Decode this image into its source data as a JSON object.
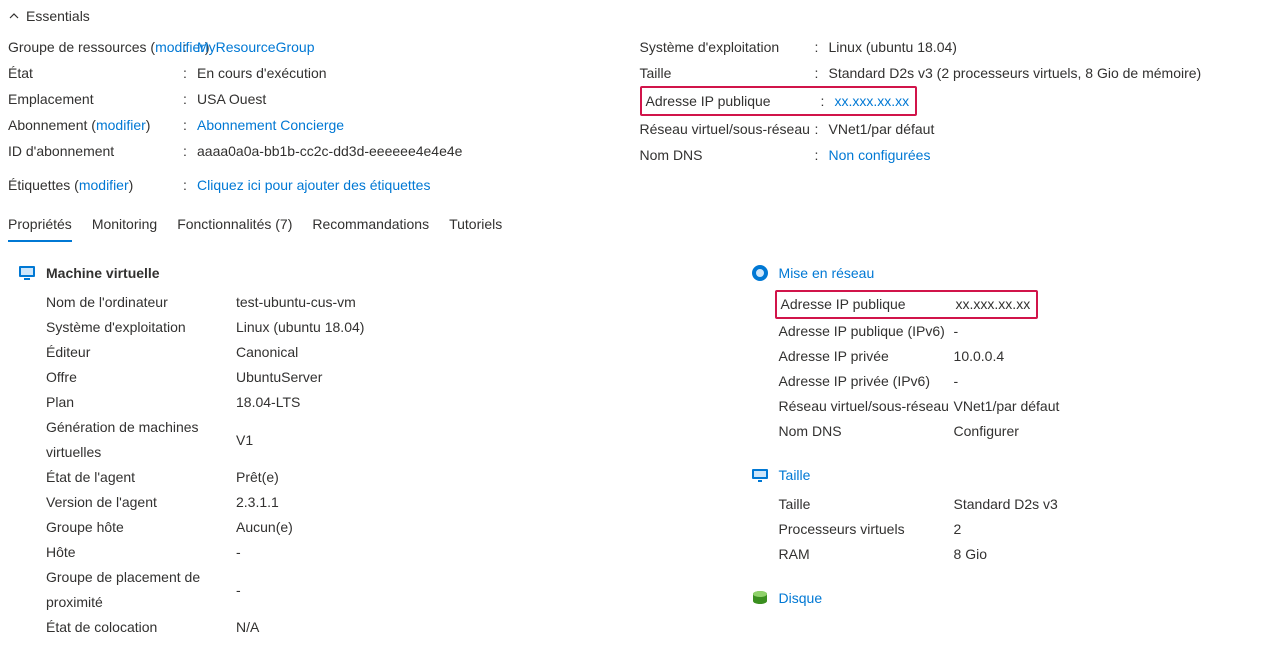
{
  "essentials": {
    "header": "Essentials",
    "left": {
      "resourceGroup_label": "Groupe de ressources",
      "resourceGroup_modify": "modifier",
      "resourceGroup_value": "MyResourceGroup",
      "status_label": "État",
      "status_value": "En cours d'exécution",
      "location_label": "Emplacement",
      "location_value": "USA Ouest",
      "subscription_label": "Abonnement",
      "subscription_modify": "modifier",
      "subscription_value": "Abonnement Concierge",
      "subId_label": "ID d'abonnement",
      "subId_value": "aaaa0a0a-bb1b-cc2c-dd3d-eeeeee4e4e4e",
      "tags_label": "Étiquettes",
      "tags_modify": "modifier",
      "tags_value": "Cliquez ici pour ajouter des étiquettes"
    },
    "right": {
      "os_label": "Système d'exploitation",
      "os_value": "Linux (ubuntu 18.04)",
      "size_label": "Taille",
      "size_value": "Standard D2s v3 (2 processeurs virtuels, 8 Gio de mémoire)",
      "pubip_label": "Adresse IP publique",
      "pubip_value": "xx.xxx.xx.xx",
      "vnet_label": "Réseau virtuel/sous-réseau",
      "vnet_value": "VNet1/par défaut",
      "dns_label": "Nom DNS",
      "dns_value": "Non configurées"
    }
  },
  "tabs": {
    "properties": "Propriétés",
    "monitoring": "Monitoring",
    "capabilities": "Fonctionnalités (7)",
    "recommendations": "Recommandations",
    "tutorials": "Tutoriels"
  },
  "vm": {
    "title": "Machine virtuelle",
    "rows": {
      "computerName_k": "Nom de l'ordinateur",
      "computerName_v": "test-ubuntu-cus-vm",
      "os_k": "Système d'exploitation",
      "os_v": "Linux (ubuntu 18.04)",
      "publisher_k": "Éditeur",
      "publisher_v": "Canonical",
      "offer_k": "Offre",
      "offer_v": "UbuntuServer",
      "plan_k": "Plan",
      "plan_v": "18.04-LTS",
      "gen_k": "Génération de machines virtuelles",
      "gen_v": "V1",
      "agentState_k": "État de l'agent",
      "agentState_v": "Prêt(e)",
      "agentVer_k": "Version de l'agent",
      "agentVer_v": "2.3.1.1",
      "hostGroup_k": "Groupe hôte",
      "hostGroup_v": "Aucun(e)",
      "host_k": "Hôte",
      "host_v": "-",
      "ppg_k": "Groupe de placement de proximité",
      "ppg_v": "-",
      "coloc_k": "État de colocation",
      "coloc_v": "N/A"
    }
  },
  "net": {
    "title": "Mise en réseau",
    "rows": {
      "pubip_k": "Adresse IP publique",
      "pubip_v": "xx.xxx.xx.xx",
      "pubip6_k": "Adresse IP publique (IPv6)",
      "pubip6_v": "-",
      "privip_k": "Adresse IP privée",
      "privip_v": "10.0.0.4",
      "privip6_k": "Adresse IP privée (IPv6)",
      "privip6_v": "-",
      "vnet_k": "Réseau virtuel/sous-réseau",
      "vnet_v": "VNet1/par défaut",
      "dns_k": "Nom DNS",
      "dns_v": "Configurer"
    }
  },
  "size": {
    "title": "Taille",
    "rows": {
      "size_k": "Taille",
      "size_v": "Standard D2s v3",
      "vcpu_k": "Processeurs virtuels",
      "vcpu_v": "2",
      "ram_k": "RAM",
      "ram_v": "8 Gio"
    }
  },
  "disk": {
    "title": "Disque"
  }
}
